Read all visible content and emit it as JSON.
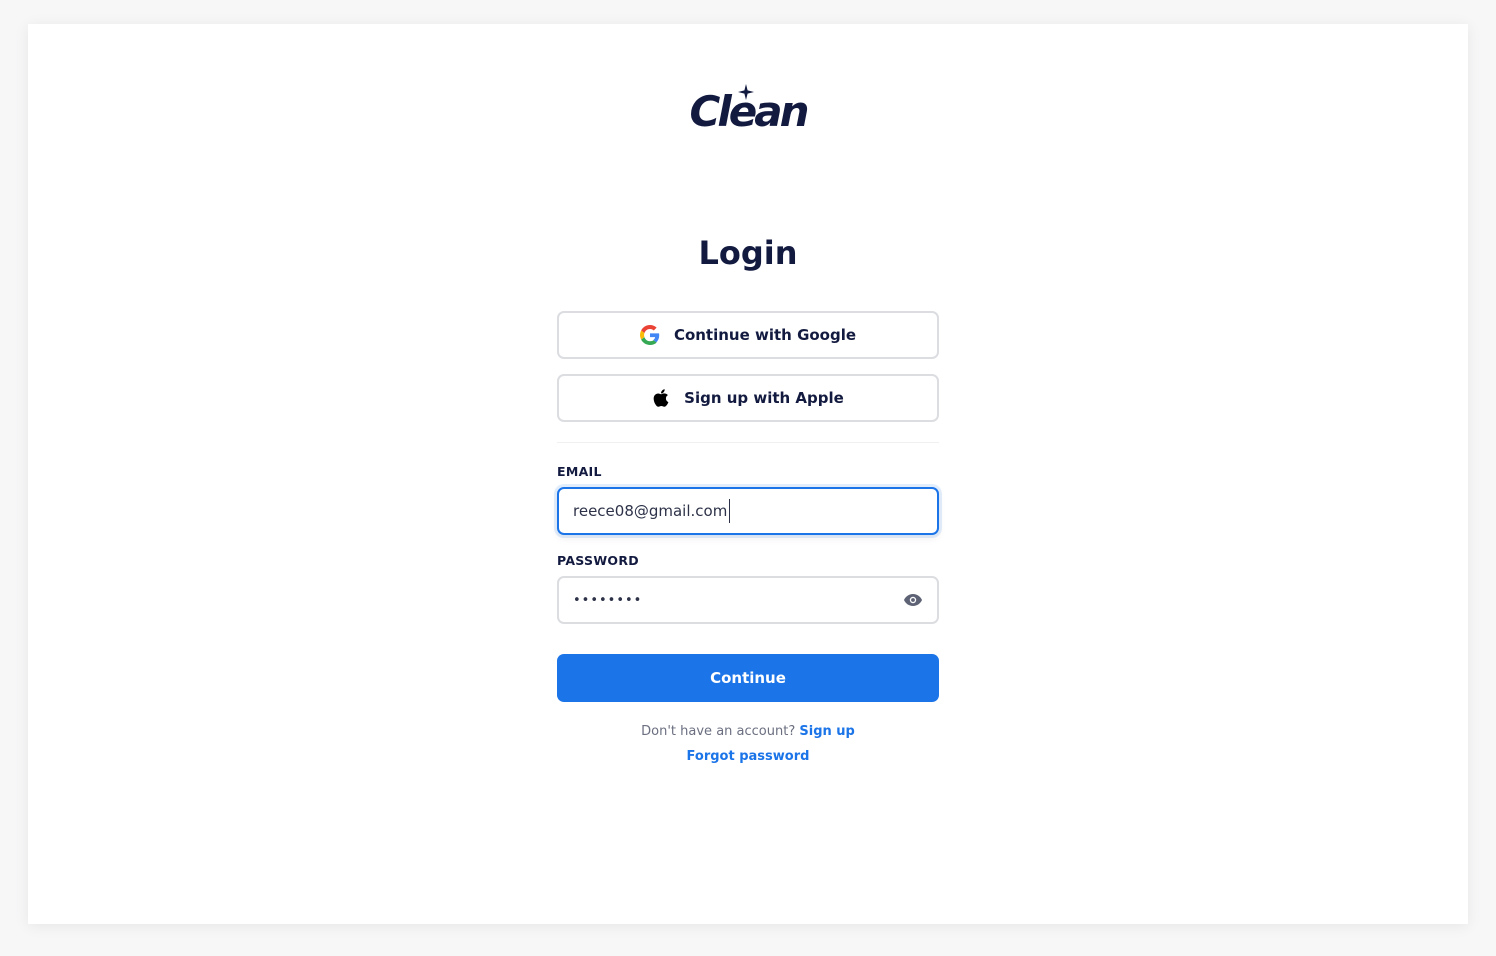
{
  "brand": {
    "logo_text": "Clean"
  },
  "page": {
    "title": "Login"
  },
  "social": {
    "google_label": "Continue with Google",
    "apple_label": "Sign up with Apple"
  },
  "form": {
    "email_label": "EMAIL",
    "email_value": "reece08@gmail.com",
    "password_label": "PASSWORD",
    "password_value": "••••••••",
    "submit_label": "Continue"
  },
  "footer": {
    "no_account_text": "Don't have an account?",
    "signup_link": "Sign up",
    "forgot_link": "Forgot password"
  },
  "colors": {
    "brand_navy": "#131a3f",
    "accent_blue": "#1b74e8",
    "border_gray": "#dcdde1"
  },
  "icons": {
    "google": "google-logo-icon",
    "apple": "apple-logo-icon",
    "password_toggle": "eye-icon",
    "logo_sparkle": "sparkle-icon"
  }
}
